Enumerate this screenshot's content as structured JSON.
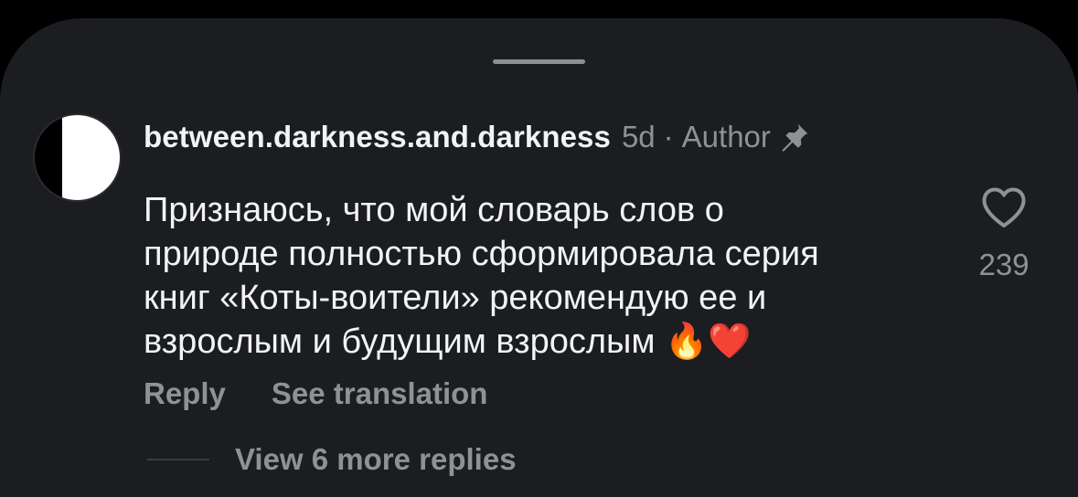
{
  "comment": {
    "username": "between.darkness.and.darkness",
    "age": "5d",
    "separator": "·",
    "author_badge": "Author",
    "pin_icon": "pin-icon",
    "text": "Признаюсь, что мой словарь слов о\nприроде полностью сформировала серия\nкниг «Коты-воители» рекомендую ее и\nвзрослым и будущим взрослым 🔥❤️",
    "actions": {
      "reply_label": "Reply",
      "translate_label": "See translation"
    },
    "like": {
      "icon": "heart-outline-icon",
      "count": "239"
    },
    "replies": {
      "label": "View 6 more replies"
    }
  },
  "colors": {
    "sheet_background": "#1c1d20",
    "primary_text": "#f2f3f5",
    "secondary_text": "#8e9297"
  }
}
